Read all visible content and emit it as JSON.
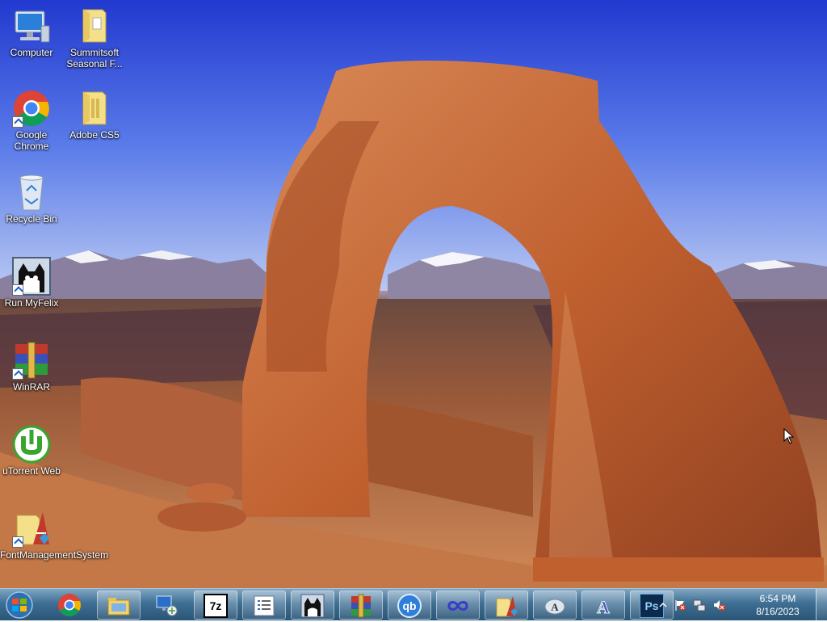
{
  "desktop": {
    "icons": [
      {
        "label": "Computer",
        "icon": "computer-icon"
      },
      {
        "label": "Summitsoft Seasonal F...",
        "icon": "folder-icon"
      },
      {
        "label": "Google Chrome",
        "icon": "chrome-icon"
      },
      {
        "label": "Adobe CS5",
        "icon": "folder-icon"
      },
      {
        "label": "Recycle Bin",
        "icon": "recycle-bin-icon"
      },
      {
        "label": "Run MyFelix",
        "icon": "felix-cat-icon"
      },
      {
        "label": "WinRAR",
        "icon": "winrar-icon"
      },
      {
        "label": "uTorrent Web",
        "icon": "utorrent-icon"
      },
      {
        "label": "FontManagementSystem",
        "icon": "font-management-icon"
      }
    ]
  },
  "taskbar": {
    "start_icon": "windows-start-icon",
    "pinned": [
      {
        "icon": "chrome-icon"
      },
      {
        "icon": "file-explorer-icon"
      },
      {
        "icon": "network-computer-icon"
      },
      {
        "icon": "7zip-icon",
        "text": "7z"
      },
      {
        "icon": "list-app-icon"
      },
      {
        "icon": "felix-cat-icon"
      },
      {
        "icon": "winrar-icon"
      },
      {
        "icon": "qbittorrent-icon",
        "text": "qb"
      },
      {
        "icon": "infinity-app-icon"
      },
      {
        "icon": "font-management-icon"
      },
      {
        "icon": "font-tool-icon"
      },
      {
        "icon": "font-creator-icon"
      },
      {
        "icon": "photoshop-icon",
        "text": "Ps"
      }
    ],
    "tray": {
      "icons": [
        "show-hidden-icons-chevron",
        "action-center-flag-icon",
        "network-icon",
        "volume-muted-icon"
      ],
      "time": "6:54 PM",
      "date": "8/16/2023"
    }
  },
  "colors": {
    "sky": "#3e62e6",
    "rock": "#c8693c",
    "taskbar": "#3f6f94"
  }
}
